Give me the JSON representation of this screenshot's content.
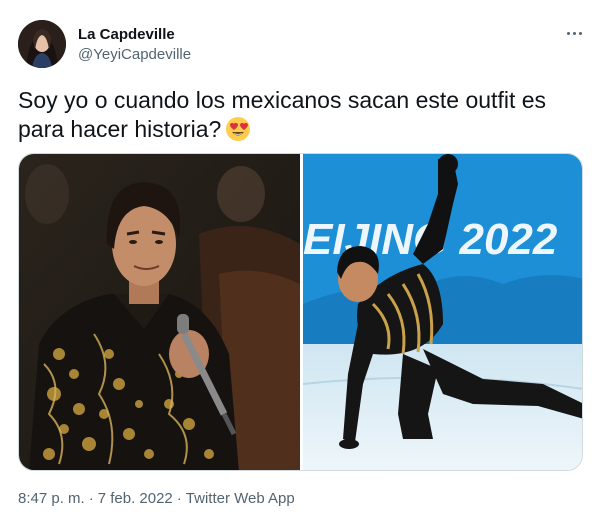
{
  "author": {
    "name": "La Capdeville",
    "handle": "@YeyiCapdeville"
  },
  "tweet": {
    "text": "Soy yo o cuando los mexicanos sacan este outfit es para hacer historia?",
    "emoji": "heart-eyes"
  },
  "media": {
    "right_photo_banner_text": "EIJING 2022"
  },
  "footer": {
    "time": "8:47 p. m.",
    "separator": "·",
    "date": "7 feb. 2022",
    "source": "Twitter Web App"
  },
  "colors": {
    "text": "#0f1419",
    "secondary": "#536471",
    "border": "#cfd9de",
    "rink_blue": "#1d8fd6"
  }
}
